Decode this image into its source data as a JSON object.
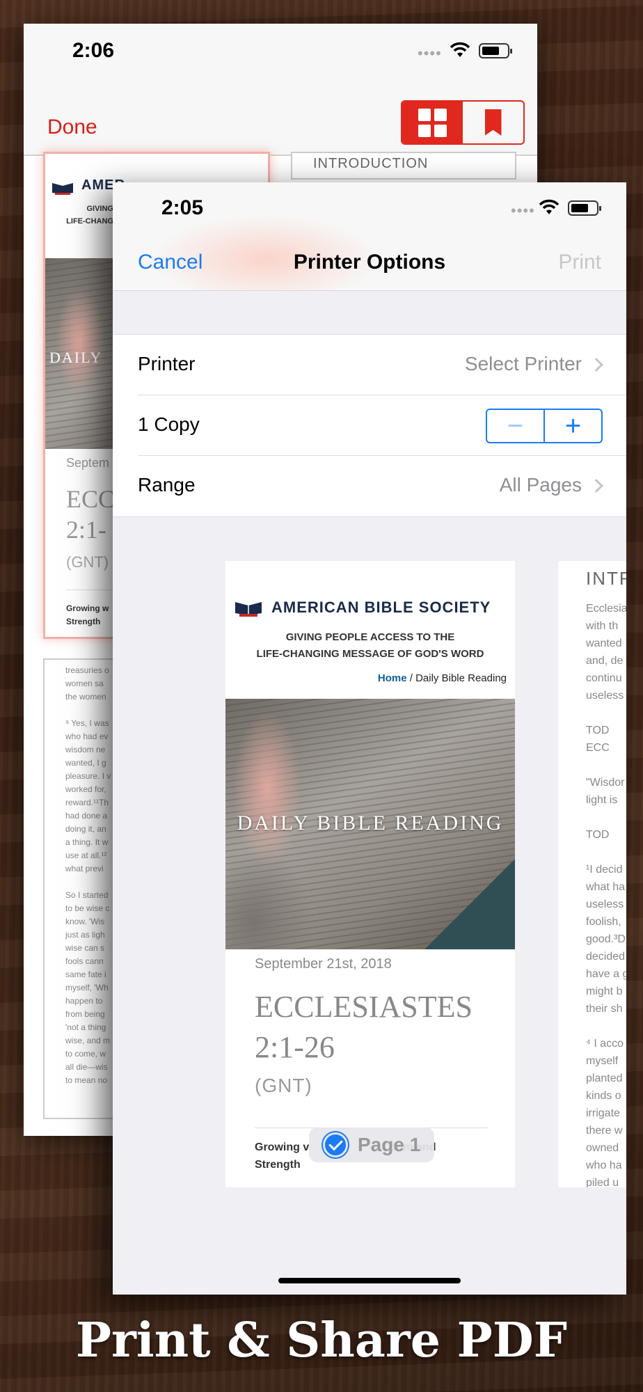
{
  "back_screen": {
    "time": "2:06",
    "done_label": "Done",
    "thumb2_heading": "INTRODUCTION",
    "thumb1_brand": "AMER",
    "thumb1_tag": "GIVING\nLIFE-CHANG",
    "thumb1_overlay": "DAILY",
    "thumb1_date": "Septem",
    "thumb1_title": "ECC\n2:1-",
    "thumb1_trans": "(GNT)",
    "thumb1_grow": "Growing w\nStrength",
    "thumb3_text": "treasuries o\nwomen sa\nthe women\n\n⁹ Yes, I was\nwho had ev\nwisdom ne\nwanted, I g\npleasure. I v\nworked for,\nreward.¹¹Th\nhad done a\ndoing it, an\na thing. It w\nuse at all.¹²\nwhat previ\n\nSo I started\nto be wise c\nknow. 'Wis\njust as ligh\nwise can s\nfools cann\nsame fate i\nmyself, 'Wh\nhappen to\nfrom being\n'not a thing\nwise, and m\nto come, w\nall die—wis\nto mean no"
  },
  "front_screen": {
    "time": "2:05",
    "cancel_label": "Cancel",
    "title": "Printer Options",
    "print_label": "Print",
    "rows": [
      {
        "label": "Printer",
        "value": "Select Printer"
      },
      {
        "label": "1 Copy",
        "minus": "−",
        "plus": "+"
      },
      {
        "label": "Range",
        "value": "All Pages"
      }
    ],
    "preview": {
      "brand": "AMERICAN BIBLE SOCIETY",
      "tagline": "GIVING PEOPLE ACCESS TO THE\nLIFE-CHANGING MESSAGE OF GOD'S WORD",
      "breadcrumb_home": "Home",
      "breadcrumb_sep": " / ",
      "breadcrumb_current": "Daily Bible Reading",
      "hero_text": "DAILY BIBLE READING",
      "date": "September 21st, 2018",
      "title": "ECCLESIASTES\n2:1-26",
      "translation": "(GNT)",
      "growing": "Growing v                          dom and\nStrength"
    },
    "page_label": "Page 1",
    "page2": {
      "heading": "INTR",
      "text": "Ecclesia\nwith th\nwanted\nand, de\ncontinu\nuseless\n\nTOD\nECC\n\n\"Wisdor\nlight is\n\nTOD\n\n¹I decid\nwhat ha\nuseless\nfoolish,\ngood.³D\ndecided\nhave a g\nmight b\ntheir sh\n\n⁴ I acco\nmyself\nplanted\nkinds o\nirrigate\nthere w\nowned\nwho ha\npiled u"
    }
  },
  "caption": "Print & Share PDF",
  "colors": {
    "accent_red": "#e0281e",
    "ios_blue": "#1a7bf5",
    "disabled": "#c7c7cc"
  }
}
